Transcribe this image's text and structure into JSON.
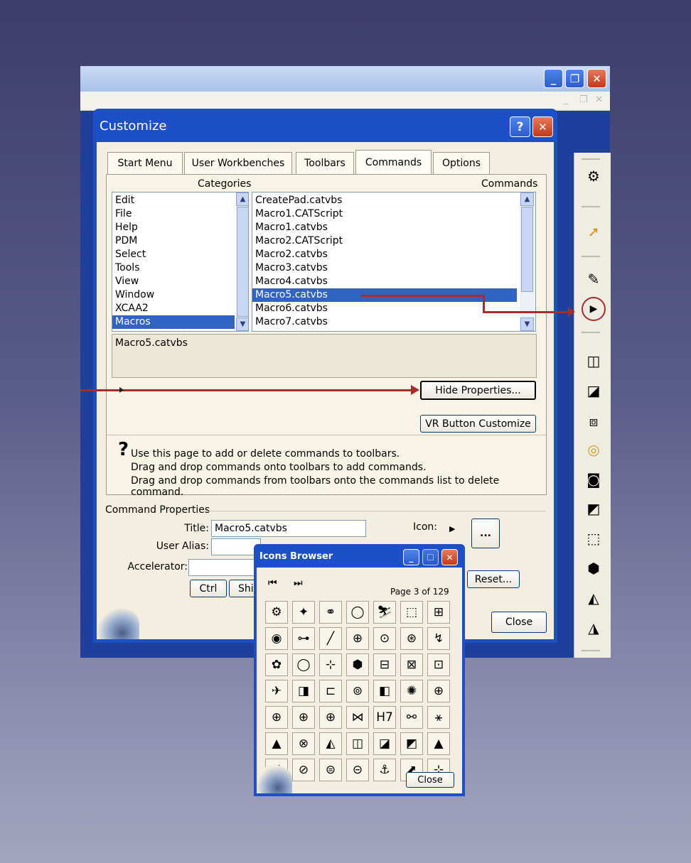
{
  "colors": {
    "accent": "#1d4fc7",
    "selection": "#3063c4",
    "annotation": "#a72c2c"
  },
  "customize": {
    "title": "Customize",
    "help_button": "?",
    "close_x": "✕",
    "tabs": [
      {
        "label": "Start Menu"
      },
      {
        "label": "User Workbenches"
      },
      {
        "label": "Toolbars"
      },
      {
        "label": "Commands",
        "active": true
      },
      {
        "label": "Options"
      }
    ],
    "categories_header": "Categories",
    "commands_header": "Commands",
    "categories": [
      "Edit",
      "File",
      "Help",
      "PDM",
      "Select",
      "Tools",
      "View",
      "Window",
      "XCAA2",
      "Macros"
    ],
    "selected_category": "Macros",
    "commands": [
      "CreatePad.catvbs",
      "Macro1.CATScript",
      "Macro1.catvbs",
      "Macro2.CATScript",
      "Macro2.catvbs",
      "Macro3.catvbs",
      "Macro4.catvbs",
      "Macro5.catvbs",
      "Macro6.catvbs",
      "Macro7.catvbs"
    ],
    "selected_command": "Macro5.catvbs",
    "description": "Macro5.catvbs",
    "hide_properties_button": "Hide Properties...",
    "vr_button": "VR Button Customize",
    "help_line1": "Use this page to add or delete commands to toolbars.",
    "help_line2": "Drag and drop commands onto toolbars to add commands.",
    "help_line3": "Drag and drop commands from toolbars onto the commands list to delete command.",
    "properties": {
      "group_label": "Command Properties",
      "title_label": "Title:",
      "title_value": "Macro5.catvbs",
      "user_alias_label": "User Alias:",
      "user_alias_value": "",
      "accelerator_label": "Accelerator:",
      "accelerator_value": "",
      "icon_label": "Icon:",
      "icon_browse_button": "...",
      "ctrl_button": "Ctrl",
      "shift_button": "Shi",
      "reset_button": "Reset..."
    },
    "close_button": "Close"
  },
  "icons_browser": {
    "title": "Icons Browser",
    "first_page": "⏮",
    "last_page": "⏭",
    "page_label": "Page 3 of 129",
    "close_button": "Close",
    "icons": [
      [
        "⚙",
        "✦",
        "⚭",
        "◯",
        "⛷",
        "⬚",
        "⊞"
      ],
      [
        "◉",
        "⊶",
        "╱",
        "⊕",
        "⊙",
        "⊛",
        "↯"
      ],
      [
        "✿",
        "◯",
        "⊹",
        "⬢",
        "⊟",
        "⊠",
        "⊡"
      ],
      [
        "✈",
        "◨",
        "⊏",
        "⊚",
        "◧",
        "✺",
        "⊕"
      ],
      [
        "⊕",
        "⊕",
        "⊕",
        "⋈",
        "H7",
        "⚯",
        "⚹"
      ],
      [
        "▲",
        "⊗",
        "◭",
        "◫",
        "◪",
        "◩",
        "▲"
      ],
      [
        "⚒",
        "⊘",
        "⊜",
        "⊝",
        "⚓",
        "⬈",
        "⊹"
      ]
    ]
  },
  "right_toolbar": {
    "icons": [
      "gear-icon",
      "select-arrow-icon",
      "sketch-icon",
      "run-macro-icon",
      "pad-icon",
      "pocket-icon",
      "shaft-icon",
      "hole-icon",
      "rib-icon",
      "face-icon",
      "solid-icon",
      "cube-icon",
      "split-icon",
      "thick-icon"
    ]
  }
}
